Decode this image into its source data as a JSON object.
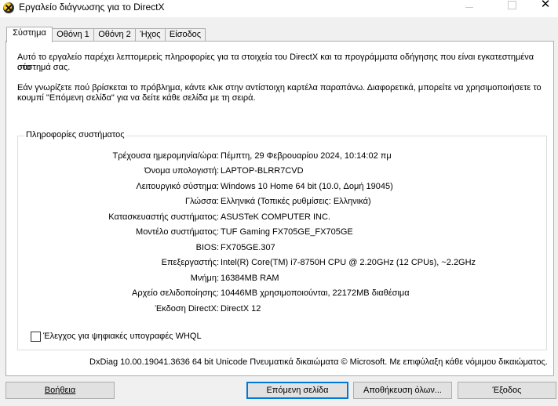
{
  "window": {
    "title": "Εργαλείο διάγνωσης για το DirectX",
    "minimize": "",
    "maximize": "",
    "close": "✕"
  },
  "tabs": [
    {
      "label": "Σύστημα",
      "active": true
    },
    {
      "label": "Οθόνη 1",
      "active": false
    },
    {
      "label": "Οθόνη 2",
      "active": false
    },
    {
      "label": "Ήχος",
      "active": false
    },
    {
      "label": "Είσοδος",
      "active": false
    }
  ],
  "intro": {
    "line1": "Αυτό το εργαλείο παρέχει λεπτομερείς πληροφορίες για τα στοιχεία του DirectX και τα προγράμματα οδήγησης που είναι εγκατεστημένα στο",
    "line2": "σύστημά σας.",
    "line3": "Εάν γνωρίζετε πού βρίσκεται το πρόβλημα, κάντε κλικ στην αντίστοιχη καρτέλα παραπάνω. Διαφορετικά, μπορείτε να χρησιμοποιήσετε το",
    "line4": "κουμπί \"Επόμενη σελίδα\" για να δείτε κάθε σελίδα με τη σειρά."
  },
  "system_info": {
    "title": "Πληροφορίες συστήματος",
    "rows": [
      {
        "label": "Τρέχουσα ημερομηνία/ώρα:",
        "value": "Πέμπτη, 29 Φεβρουαρίου 2024, 10:14:02 πμ"
      },
      {
        "label": "Όνομα υπολογιστή:",
        "value": "LAPTOP-BLRR7CVD"
      },
      {
        "label": "Λειτουργικό σύστημα:",
        "value": "Windows 10 Home 64 bit (10.0, Δομή 19045)"
      },
      {
        "label": "Γλώσσα:",
        "value": "Ελληνικά (Τοπικές ρυθμίσεις: Ελληνικά)"
      },
      {
        "label": "Κατασκευαστής συστήματος:",
        "value": "ASUSTeK COMPUTER INC."
      },
      {
        "label": "Μοντέλο συστήματος:",
        "value": "TUF Gaming FX705GE_FX705GE"
      },
      {
        "label": "BIOS:",
        "value": "FX705GE.307"
      },
      {
        "label": "Επεξεργαστής:",
        "value": "Intel(R) Core(TM) i7-8750H CPU @ 2.20GHz (12 CPUs), ~2.2GHz"
      },
      {
        "label": "Μνήμη:",
        "value": "16384MB RAM"
      },
      {
        "label": "Αρχείο σελιδοποίησης:",
        "value": "10446MB χρησιμοποιούνται, 22172MB διαθέσιμα"
      },
      {
        "label": "Έκδοση DirectX:",
        "value": "DirectX 12"
      }
    ]
  },
  "whql": {
    "label": "Έλεγχος για ψηφιακές υπογραφές WHQL",
    "checked": false
  },
  "copyright": "DxDiag 10.00.19041.3636 64 bit Unicode  Πνευματικά δικαιώματα © Microsoft. Με επιφύλαξη κάθε νόμιμου δικαιώματος.",
  "buttons": {
    "help": "Βοήθεια",
    "next_page": "Επόμενη σελίδα",
    "save_all": "Αποθήκευση όλων...",
    "exit": "Έξοδος"
  }
}
